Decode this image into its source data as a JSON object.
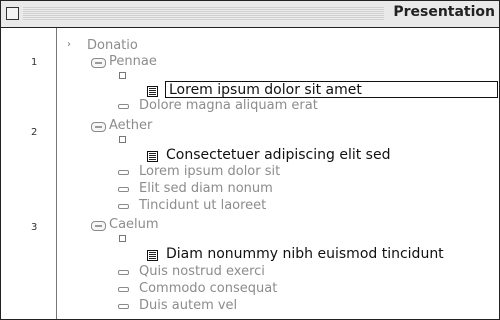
{
  "window": {
    "title": "Presentation"
  },
  "rows": {
    "donatio": "Donatio",
    "pennae": "Pennae",
    "lorem_edit": "Lorem ipsum dolor sit amet",
    "dolore": "Dolore magna aliquam erat",
    "aether": "Aether",
    "consectetuer": "Consectetuer adipiscing elit sed",
    "lorem2": "Lorem ipsum dolor sit",
    "elit": "Elit sed diam nonum",
    "tincidunt_ut": "Tincidunt ut laoreet",
    "caelum": "Caelum",
    "diam": "Diam nonummy nibh euismod tincidunt",
    "quis": "Quis nostrud exerci",
    "commodo": "Commodo consequat",
    "duis": "Duis autem vel"
  },
  "line_numbers": [
    "1",
    "2",
    "3"
  ]
}
